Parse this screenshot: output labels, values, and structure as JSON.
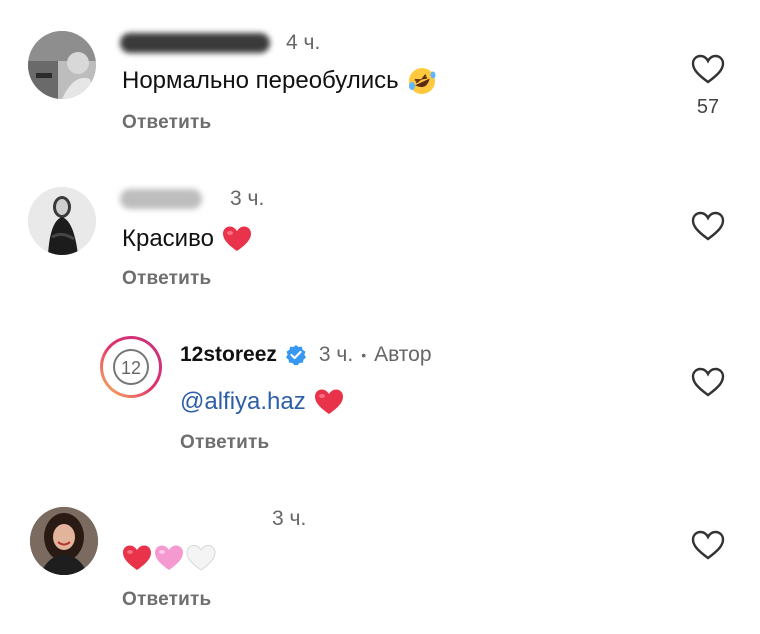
{
  "comments": [
    {
      "time": "4 ч.",
      "text": "Нормально переобулись",
      "emoji": "rofl-emoji",
      "reply_label": "Ответить",
      "likes": "57"
    },
    {
      "time": "3 ч.",
      "text": "Красиво",
      "emoji": "red-heart-emoji",
      "reply_label": "Ответить"
    },
    {
      "username": "12storeez",
      "time": "3 ч.",
      "separator": "•",
      "author_label": "Автор",
      "text": "@alfiya.haz",
      "emoji": "red-heart-emoji",
      "reply_label": "Ответить"
    },
    {
      "time": "3 ч.",
      "emojis": [
        "red-heart-emoji",
        "pink-heart-emoji",
        "white-heart-emoji"
      ],
      "reply_label": "Ответить"
    }
  ],
  "colors": {
    "red_heart": "#e8334a",
    "pink_heart": "#f59ad0",
    "white_heart": "#f4f4f4",
    "verified_blue": "#3897f0",
    "mention": "#2d5ea8"
  }
}
